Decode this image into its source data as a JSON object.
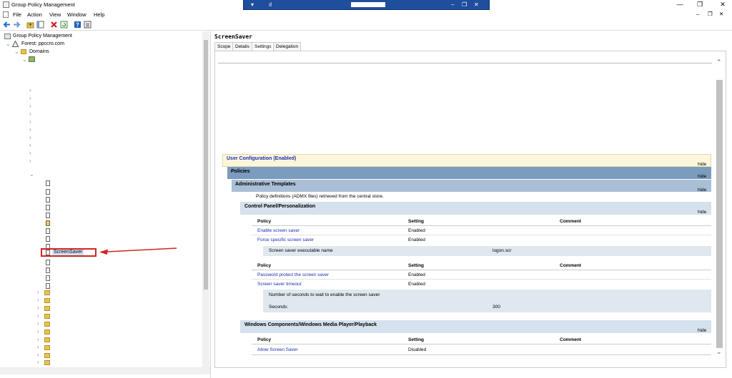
{
  "window": {
    "title": "Group Policy Management",
    "controls": {
      "minimize": "—",
      "restore": "❐",
      "close": "✕"
    },
    "inner_controls": {
      "minimize": "–",
      "restore": "❐",
      "close": "✕"
    }
  },
  "menu": [
    "File",
    "Action",
    "View",
    "Window",
    "Help"
  ],
  "toolbar": {
    "icons": [
      "back-arrow-icon",
      "forward-arrow-icon",
      "folder-up-icon",
      "console-tree-icon",
      "delete-icon",
      "refresh-icon",
      "help-icon",
      "properties-icon"
    ]
  },
  "tree": {
    "root": "Group Policy Management",
    "forest": "Forest: ppccro.com",
    "domains": "Domains",
    "selected": "ScreenSaver"
  },
  "gpo": {
    "name": "ScreenSaver",
    "tabs": [
      "Scope",
      "Details",
      "Settings",
      "Delegation"
    ],
    "active_tab": "Settings"
  },
  "report": {
    "hide_label": "hide",
    "user_config": "User Configuration (Enabled)",
    "policies": "Policies",
    "admin_templates": "Administrative Templates",
    "admx_note": "Policy definitions (ADMX files) retrieved from the central store.",
    "cp_section": "Control Panel/Personalization",
    "col_policy": "Policy",
    "col_setting": "Setting",
    "col_comment": "Comment",
    "cp_rows": [
      {
        "policy": "Enable screen saver",
        "setting": "Enabled"
      },
      {
        "policy": "Force specific screen saver",
        "setting": "Enabled"
      }
    ],
    "exe_label": "Screen saver executable name",
    "exe_value": "logon.scr",
    "cp_rows2": [
      {
        "policy": "Password protect the screen saver",
        "setting": "Enabled"
      },
      {
        "policy": "Screen saver timeout",
        "setting": "Enabled"
      }
    ],
    "timeout_note": "Number of seconds to wait to enable the screen saver",
    "seconds_label": "Seconds:",
    "seconds_value": "300",
    "wmp_section": "Windows Components/Windows Media Player/Playback",
    "wmp_rows": [
      {
        "policy": "Allow Screen Saver",
        "setting": "Disabled"
      }
    ]
  },
  "colors": {
    "rd_bar": "#1f4e9c",
    "user_config_bg": "#fdf6dc",
    "policies_bg": "#7b9cbf",
    "admin_bg": "#a9bfd6",
    "section_bg": "#d5e1ec",
    "sub_bg": "#dfe7ef",
    "link": "#1a2fb3",
    "callout": "#d32323"
  }
}
